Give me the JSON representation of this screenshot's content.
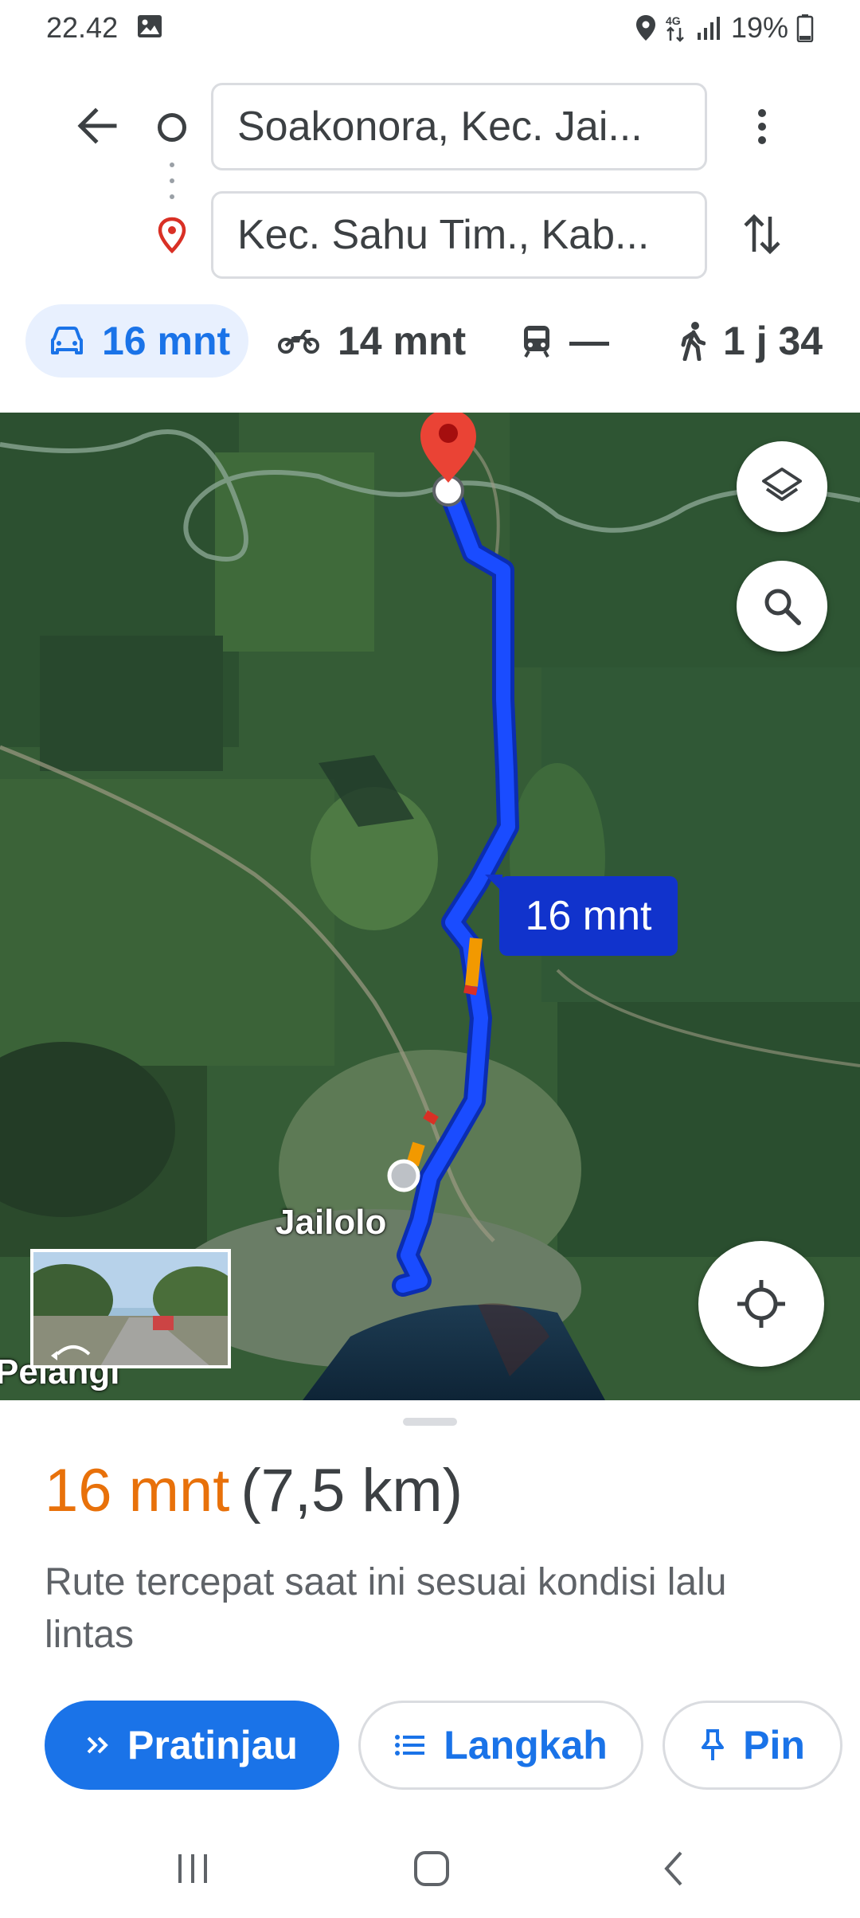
{
  "status_bar": {
    "time": "22.42",
    "battery": "19%",
    "network": "4G"
  },
  "directions": {
    "origin": "Soakonora, Kec. Jai...",
    "destination": "Kec. Sahu Tim., Kab..."
  },
  "modes": [
    {
      "name": "car",
      "label": "16 mnt",
      "selected": true
    },
    {
      "name": "motorcycle",
      "label": "14 mnt"
    },
    {
      "name": "transit",
      "label": "—"
    },
    {
      "name": "walk",
      "label": "1 j 34"
    }
  ],
  "map": {
    "route_badge": "16 mnt",
    "place_label": "Jailolo",
    "place_label_2": "Pelangi",
    "route_color": "#1a4cff",
    "traffic_slow_color": "#f29900",
    "traffic_jam_color": "#d93025"
  },
  "summary": {
    "duration": "16 mnt",
    "distance": "(7,5 km)",
    "description": "Rute tercepat saat ini sesuai kondisi lalu lintas"
  },
  "actions": {
    "preview": "Pratinjau",
    "steps": "Langkah",
    "pin": "Pin"
  },
  "colors": {
    "accent": "#1a73e8",
    "duration": "#e8710a"
  }
}
